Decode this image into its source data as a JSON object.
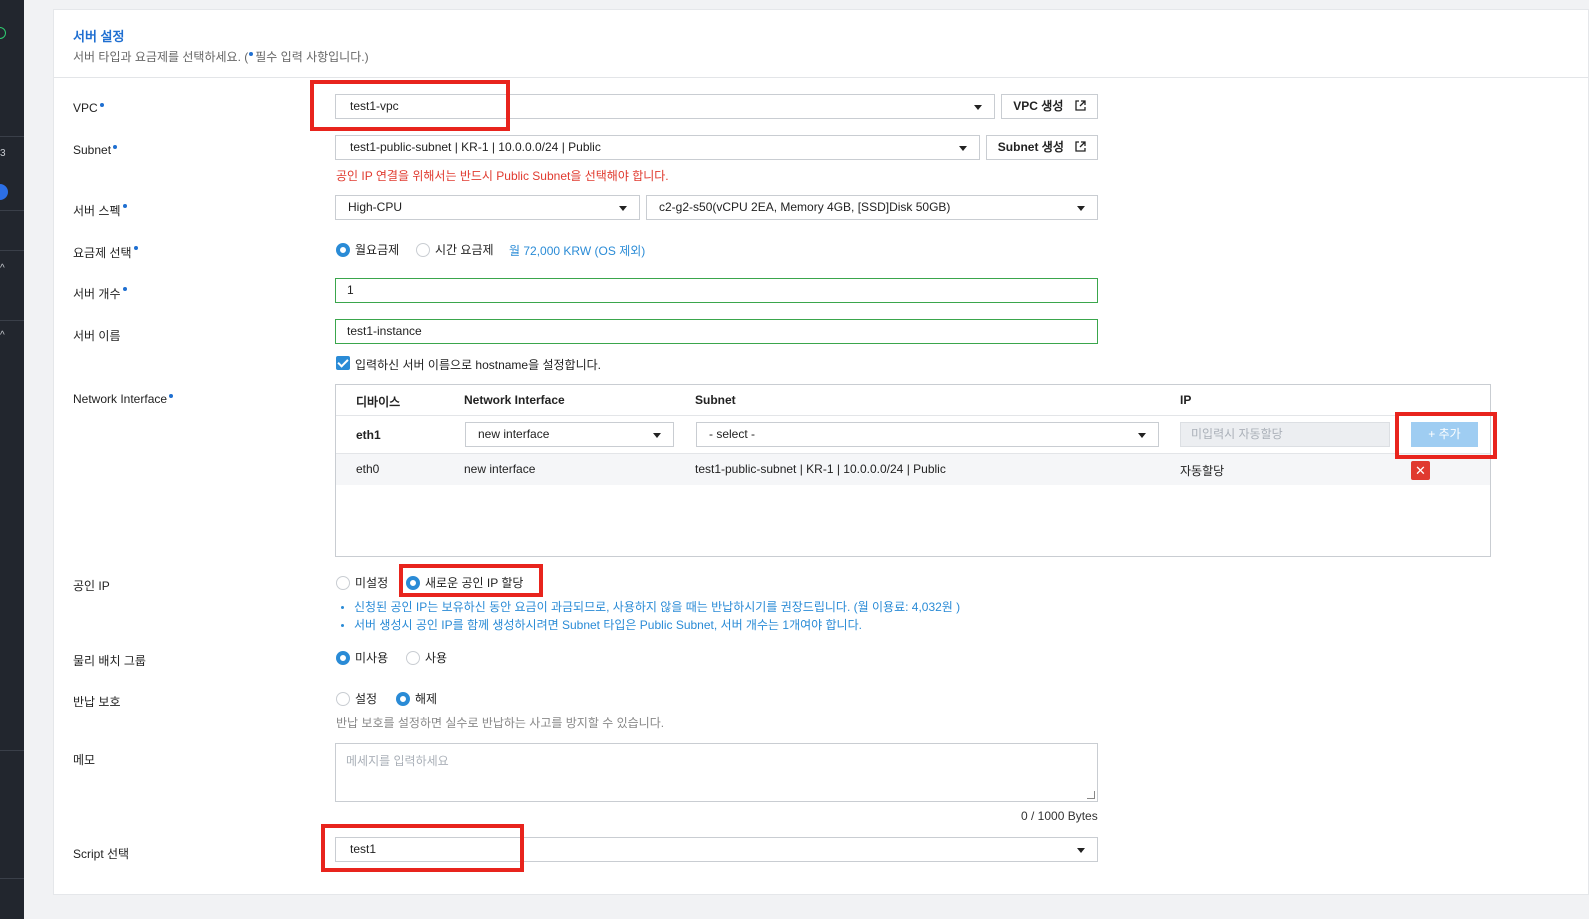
{
  "section": {
    "title": "서버 설정",
    "desc_before": "서버 타입과 요금제를 선택하세요. (",
    "desc_after": "필수 입력 사항입니다.)"
  },
  "vpc": {
    "label": "VPC",
    "value": "test1-vpc",
    "create_button": "VPC 생성"
  },
  "subnet": {
    "label": "Subnet",
    "value": "test1-public-subnet | KR-1 | 10.0.0.0/24 | Public",
    "create_button": "Subnet 생성",
    "warning": "공인 IP 연결을 위해서는 반드시 Public Subnet을 선택해야 합니다."
  },
  "spec": {
    "label": "서버 스펙",
    "type": "High-CPU",
    "flavor": "c2-g2-s50(vCPU 2EA, Memory 4GB, [SSD]Disk 50GB)"
  },
  "pricing": {
    "label": "요금제 선택",
    "options": [
      "월요금제",
      "시간 요금제"
    ],
    "selected": "월요금제",
    "price_note": "월 72,000 KRW (OS 제외)"
  },
  "server_count": {
    "label": "서버 개수",
    "value": "1"
  },
  "server_name": {
    "label": "서버 이름",
    "value": "test1-instance",
    "hostname_checkbox": "입력하신 서버 이름으로 hostname을 설정합니다.",
    "hostname_checked": true
  },
  "network_interface": {
    "label": "Network Interface",
    "columns": [
      "디바이스",
      "Network Interface",
      "Subnet",
      "IP"
    ],
    "edit_row": {
      "device": "eth1",
      "interface": "new interface",
      "subnet": "- select -",
      "ip_placeholder": "미입력시 자동할당",
      "add_button": "+ 추가"
    },
    "rows": [
      {
        "device": "eth0",
        "interface": "new interface",
        "subnet": "test1-public-subnet | KR-1 | 10.0.0.0/24 | Public",
        "ip": "자동할당",
        "delete": "✕"
      }
    ]
  },
  "public_ip": {
    "label": "공인 IP",
    "options": [
      "미설정",
      "새로운 공인 IP 할당"
    ],
    "selected": "새로운 공인 IP 할당",
    "notes": [
      "신청된 공인 IP는 보유하신 동안 요금이 과금되므로, 사용하지 않을 때는 반납하시기를 권장드립니다. (월 이용료: 4,032원 )",
      "서버 생성시 공인 IP를 함께 생성하시려면 Subnet 타입은 Public Subnet, 서버 개수는 1개여야 합니다."
    ]
  },
  "placement_group": {
    "label": "물리 배치 그룹",
    "options": [
      "미사용",
      "사용"
    ],
    "selected": "미사용"
  },
  "return_protection": {
    "label": "반납 보호",
    "options": [
      "설정",
      "해제"
    ],
    "selected": "해제",
    "hint": "반납 보호를 설정하면 실수로 반납하는 사고를 방지할 수 있습니다."
  },
  "memo": {
    "label": "메모",
    "placeholder": "메세지를 입력하세요",
    "counter": "0 / 1000 Bytes"
  },
  "script": {
    "label": "Script 선택",
    "value": "test1"
  },
  "colors": {
    "accent": "#2a8bd6",
    "title": "#1f6fd1",
    "warning": "#e03a2f",
    "highlight": "#e8241d",
    "valid": "#3aa64c"
  },
  "sidebar_marks": [
    "3",
    "^",
    "^"
  ]
}
